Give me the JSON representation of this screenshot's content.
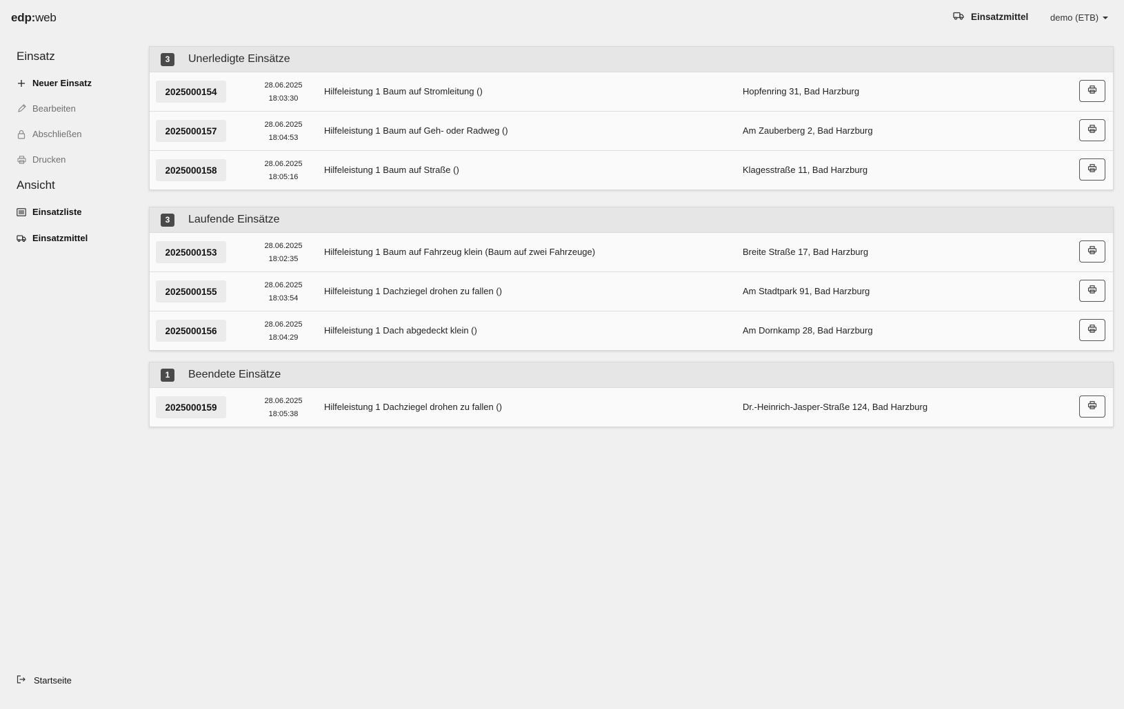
{
  "header": {
    "brand_bold": "edp:",
    "brand_rest": "web",
    "vehicles_label": "Einsatzmittel",
    "user_label": "demo (ETB)"
  },
  "sidebar": {
    "section1": "Einsatz",
    "items1": [
      {
        "label": "Neuer Einsatz",
        "icon": "plus-icon",
        "state": "enabled"
      },
      {
        "label": "Bearbeiten",
        "icon": "pencil-icon",
        "state": "disabled"
      },
      {
        "label": "Abschließen",
        "icon": "lock-icon",
        "state": "disabled"
      },
      {
        "label": "Drucken",
        "icon": "printer-icon",
        "state": "disabled"
      }
    ],
    "section2": "Ansicht",
    "items2": [
      {
        "label": "Einsatzliste",
        "icon": "list-icon"
      },
      {
        "label": "Einsatzmittel",
        "icon": "truck-icon"
      }
    ],
    "bottom_label": "Startseite"
  },
  "panels": [
    {
      "count": "3",
      "title": "Unerledigte Einsätze",
      "rows": [
        {
          "id": "2025000154",
          "date": "28.06.2025",
          "time": "18:03:30",
          "desc": "Hilfeleistung 1 Baum auf Stromleitung ()",
          "addr": "Hopfenring 31, Bad Harzburg"
        },
        {
          "id": "2025000157",
          "date": "28.06.2025",
          "time": "18:04:53",
          "desc": "Hilfeleistung 1 Baum auf Geh- oder Radweg ()",
          "addr": "Am Zauberberg 2, Bad Harzburg"
        },
        {
          "id": "2025000158",
          "date": "28.06.2025",
          "time": "18:05:16",
          "desc": "Hilfeleistung 1 Baum auf Straße ()",
          "addr": "Klagesstraße 11, Bad Harzburg"
        }
      ]
    },
    {
      "count": "3",
      "title": "Laufende Einsätze",
      "rows": [
        {
          "id": "2025000153",
          "date": "28.06.2025",
          "time": "18:02:35",
          "desc": "Hilfeleistung 1 Baum auf Fahrzeug klein (Baum auf zwei Fahrzeuge)",
          "addr": "Breite Straße 17, Bad Harzburg"
        },
        {
          "id": "2025000155",
          "date": "28.06.2025",
          "time": "18:03:54",
          "desc": "Hilfeleistung 1 Dachziegel drohen zu fallen ()",
          "addr": "Am Stadtpark 91, Bad Harzburg"
        },
        {
          "id": "2025000156",
          "date": "28.06.2025",
          "time": "18:04:29",
          "desc": "Hilfeleistung 1 Dach abgedeckt klein ()",
          "addr": "Am Dornkamp 28, Bad Harzburg"
        }
      ]
    },
    {
      "count": "1",
      "title": "Beendete Einsätze",
      "rows": [
        {
          "id": "2025000159",
          "date": "28.06.2025",
          "time": "18:05:38",
          "desc": "Hilfeleistung 1 Dachziegel drohen zu fallen ()",
          "addr": "Dr.-Heinrich-Jasper-Straße 124, Bad Harzburg"
        }
      ]
    }
  ]
}
